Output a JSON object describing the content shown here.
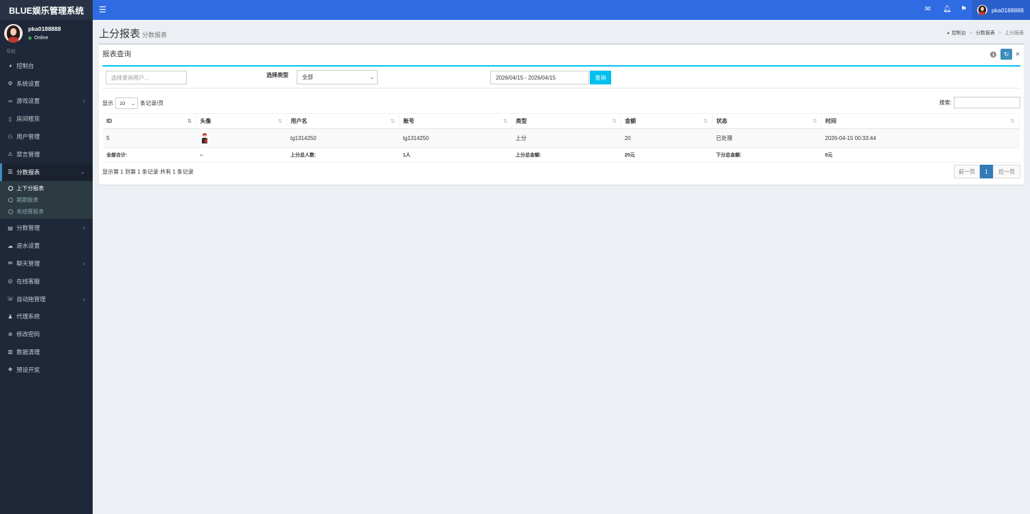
{
  "app": {
    "title": "BLUE娱乐管理系统"
  },
  "user": {
    "name": "pka0188888",
    "status": "Online"
  },
  "sidebar": {
    "header": "导航",
    "items": [
      {
        "label": "控制台",
        "icon": "dashboard-icon",
        "glyph": "◕"
      },
      {
        "label": "系统设置",
        "icon": "cogs-icon",
        "glyph": "⚙"
      },
      {
        "label": "游戏设置",
        "icon": "gamepad-icon",
        "glyph": "∞",
        "chevron": "‹"
      },
      {
        "label": "房间租赁",
        "icon": "file-icon",
        "glyph": "▯"
      },
      {
        "label": "用户管理",
        "icon": "users-icon",
        "glyph": "⚇"
      },
      {
        "label": "禁言管理",
        "icon": "warning-icon",
        "glyph": "⚠"
      },
      {
        "label": "分数报表",
        "icon": "list-icon",
        "glyph": "☰",
        "chevron": "⌄"
      }
    ],
    "submenu": [
      {
        "label": "上下分报表"
      },
      {
        "label": "期期报表"
      },
      {
        "label": "未结算报表"
      }
    ],
    "items2": [
      {
        "label": "分数管理",
        "icon": "database-icon",
        "glyph": "▤",
        "chevron": "‹"
      },
      {
        "label": "退水设置",
        "icon": "cloud-icon",
        "glyph": "☁"
      },
      {
        "label": "聊天管理",
        "icon": "comments-icon",
        "glyph": "✉",
        "chevron": "‹"
      },
      {
        "label": "在线客服",
        "icon": "life-ring-icon",
        "glyph": "◎"
      },
      {
        "label": "自动拖管理",
        "icon": "comment-icon",
        "glyph": "☏",
        "chevron": "‹"
      },
      {
        "label": "代理系统",
        "icon": "user-plus-icon",
        "glyph": "♟"
      },
      {
        "label": "修改密码",
        "icon": "gear-icon",
        "glyph": "✲"
      },
      {
        "label": "数据清理",
        "icon": "trash-icon",
        "glyph": "▥"
      },
      {
        "label": "预设开奖",
        "icon": "cubes-icon",
        "glyph": "❖"
      }
    ]
  },
  "page": {
    "title": "上分报表",
    "subtitle": "分数报表"
  },
  "breadcrumb": {
    "home": "控制台",
    "parent": "分数报表",
    "current": "上分报表",
    "sep": ">"
  },
  "box": {
    "title": "报表查询"
  },
  "filter": {
    "user_placeholder": "选择查询用户...",
    "type_label": "选择类型",
    "type_value": "全部",
    "date_range": "2026/04/15 - 2026/04/15",
    "query_label": "查询"
  },
  "table_controls": {
    "show_prefix": "显示",
    "page_length": "10",
    "show_suffix": "条记录/页",
    "search_label": "搜索:"
  },
  "table": {
    "headers": [
      "ID",
      "头像",
      "用户名",
      "账号",
      "类型",
      "金额",
      "状态",
      "时间"
    ],
    "rows": [
      {
        "id": "5",
        "username": "tg1314250",
        "account": "tg1314250",
        "type": "上分",
        "amount": "20",
        "status": "已处理",
        "time": "2026-04-15 00:33:44"
      }
    ],
    "footer": [
      "全部合计:",
      "--",
      "上分总人数:",
      "1人",
      "上分总金额:",
      "20元",
      "下分总金额:",
      "0元"
    ]
  },
  "pagination": {
    "info": "显示第 1 到第 1 条记录 共有 1 条记录",
    "prev": "前一页",
    "current": "1",
    "next": "后一页"
  },
  "colors": {
    "topbar": "#2f6be3",
    "sidebar": "#1e2838",
    "accent": "#00c0ef",
    "primary": "#337ab7"
  }
}
